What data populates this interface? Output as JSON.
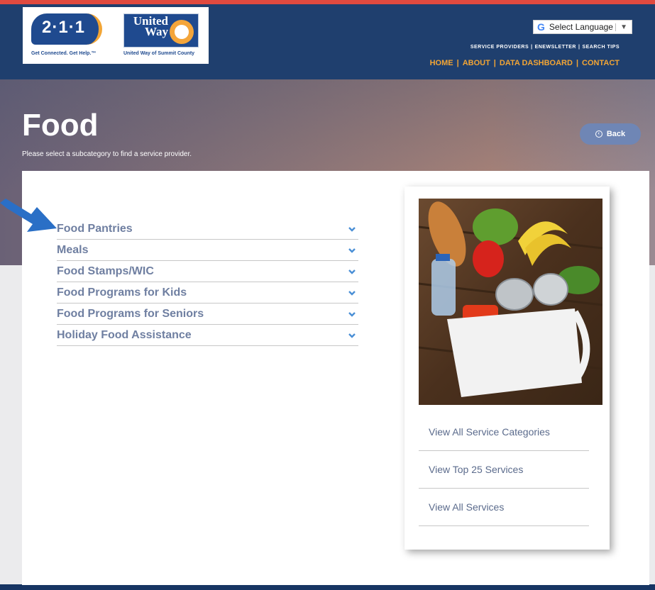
{
  "header": {
    "logo_211": {
      "number": "2·1·1",
      "tagline": "Get Connected. Get Help.™"
    },
    "logo_united_way": {
      "name": "United Way",
      "tagline": "United Way of Summit County"
    },
    "language": {
      "label": "Select Language",
      "dropdown_arrow": "▼"
    },
    "secondary_nav": [
      "SERVICE PROVIDERS",
      "ENEWSLETTER",
      "SEARCH TIPS"
    ],
    "primary_nav": [
      "HOME",
      "ABOUT",
      "DATA DASHBOARD",
      "CONTACT"
    ]
  },
  "hero": {
    "title": "Food",
    "subtitle": "Please select a subcategory to find a service provider.",
    "back_label": "Back"
  },
  "subcategories": [
    {
      "label": "Food Pantries"
    },
    {
      "label": "Meals"
    },
    {
      "label": "Food Stamps/WIC"
    },
    {
      "label": "Food Programs for Kids"
    },
    {
      "label": "Food Programs for Seniors"
    },
    {
      "label": "Holiday Food Assistance"
    }
  ],
  "side_links": [
    "View All Service Categories",
    "View Top 25 Services",
    "View All Services"
  ],
  "colors": {
    "header_bg": "#1f3f6e",
    "accent_red": "#e04a3f",
    "nav_orange": "#f2a535",
    "list_text": "#6f7fa1",
    "chevron": "#4a8fd6",
    "pointer_arrow": "#2a6fc6"
  },
  "icons": {
    "chevron": "chevron-down-icon",
    "back": "circle-arrow-left-icon",
    "pointer": "pointer-arrow-icon",
    "google": "google-g-icon"
  }
}
